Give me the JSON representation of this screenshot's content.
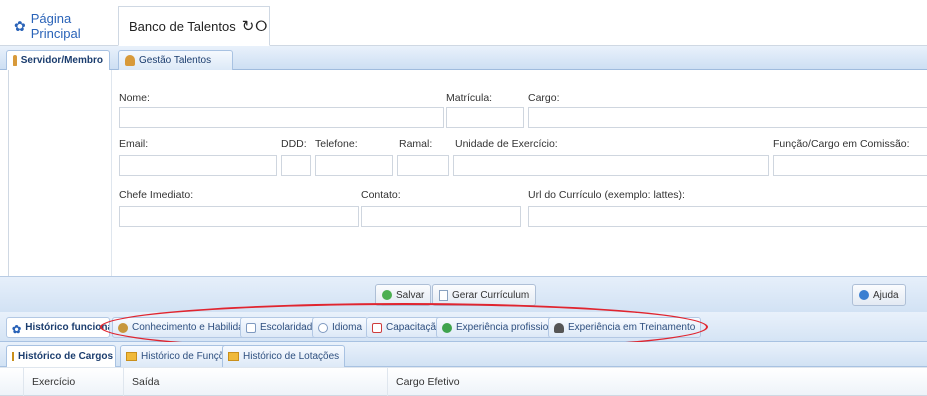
{
  "top_tabs": {
    "home_label": "Página Principal",
    "talent_label": "Banco de Talentos"
  },
  "sub_tabs": {
    "servidor": "Servidor/Membro",
    "gestao": "Gestão Talentos"
  },
  "form": {
    "nome": "Nome:",
    "matricula": "Matrícula:",
    "cargo": "Cargo:",
    "email": "Email:",
    "ddd": "DDD:",
    "telefone": "Telefone:",
    "ramal": "Ramal:",
    "unidade": "Unidade de Exercício:",
    "funcao": "Função/Cargo em Comissão:",
    "chefe": "Chefe Imediato:",
    "contato": "Contato:",
    "url": "Url do Currículo (exemplo: lattes):"
  },
  "buttons": {
    "salvar": "Salvar",
    "gerar": "Gerar Currículum",
    "ajuda": "Ajuda"
  },
  "history_tabs": {
    "funcional": "Histórico funcional",
    "conhecimento": "Conhecimento e Habilidade",
    "escolaridade": "Escolaridade",
    "idioma": "Idioma",
    "capacitacao": "Capacitação",
    "exp_profissional": "Experiência profissional",
    "exp_treinamento": "Experiência em Treinamento"
  },
  "cargo_tabs": {
    "cargos": "Histórico de Cargos",
    "funcoes": "Histórico de Funções",
    "lotacoes": "Histórico de Lotações"
  },
  "table": {
    "headers": [
      "Exercício",
      "Saída",
      "Cargo Efetivo"
    ]
  }
}
